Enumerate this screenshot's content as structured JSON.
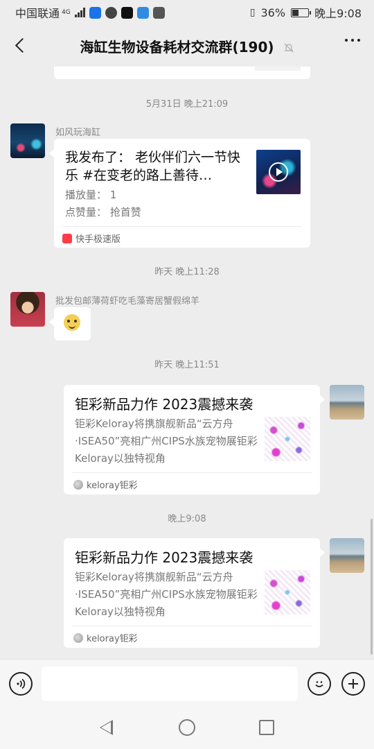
{
  "status_bar": {
    "carrier": "中国联通",
    "network": "4G",
    "battery": "36%",
    "time": "晚上9:08",
    "icons": [
      "shield-app-icon",
      "chrome-icon",
      "tiktok-icon",
      "cloud-icon",
      "media-icon",
      "signal-icon",
      "vibrate-icon",
      "battery-icon"
    ]
  },
  "header": {
    "title": "海缸生物设备耗材交流群(190)",
    "icons": [
      "back-arrow-icon",
      "mute-bell-icon",
      "more-dots-icon"
    ]
  },
  "messages": {
    "t1": "5月31日 晚上21:09",
    "m1": {
      "sender": "如风玩海缸",
      "title": "我发布了： 老伙伴们六一节快乐 #在变老的路上善待…",
      "plays": "播放量： 1",
      "likes": "点赞量： 抢首赞",
      "source": "快手极速版"
    },
    "t2": "昨天 晚上11:28",
    "m2": {
      "sender": "批发包邮薄荷虾吃毛藻寄居蟹假绵羊",
      "sticker": "doge-sticker-icon"
    },
    "t3": "昨天 晚上11:51",
    "m3": {
      "title": "钜彩新品力作 2023震撼来袭",
      "desc": "钜彩Keloray将携旗舰新品“云方舟·ISEA50”亮相广州CIPS水族宠物展钜彩Keloray以独特视角",
      "source": "keloray钜彩"
    },
    "t4": "晚上9:08",
    "m4": {
      "title": "钜彩新品力作 2023震撼来袭",
      "desc": "钜彩Keloray将携旗舰新品“云方舟·ISEA50”亮相广州CIPS水族宠物展钜彩Keloray以独特视角",
      "source": "keloray钜彩"
    }
  },
  "input_bar": {
    "icons": [
      "voice-icon",
      "emoji-icon",
      "plus-icon"
    ]
  },
  "nav_bar": {
    "icons": [
      "nav-back-icon",
      "nav-home-icon",
      "nav-recent-icon"
    ]
  }
}
